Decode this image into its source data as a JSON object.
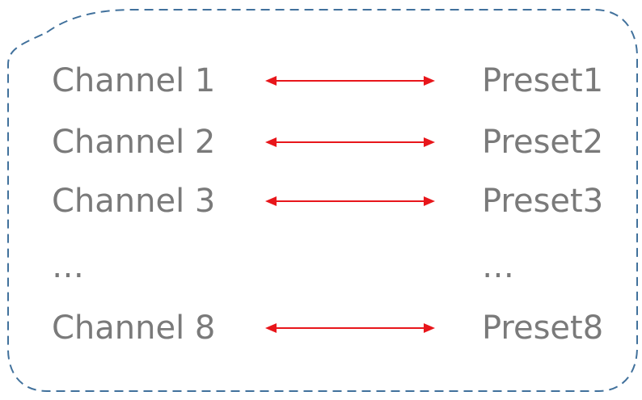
{
  "mappings": [
    {
      "channel": "Channel 1",
      "preset": "Preset1",
      "arrow": true
    },
    {
      "channel": "Channel 2",
      "preset": "Preset2",
      "arrow": true
    },
    {
      "channel": "Channel 3",
      "preset": "Preset3",
      "arrow": true
    },
    {
      "channel": "…",
      "preset": "…",
      "arrow": false
    },
    {
      "channel": "Channel 8",
      "preset": "Preset8",
      "arrow": true
    }
  ],
  "colors": {
    "border": "#41719c",
    "arrow": "#e8161b",
    "text": "#7a7a7a"
  }
}
